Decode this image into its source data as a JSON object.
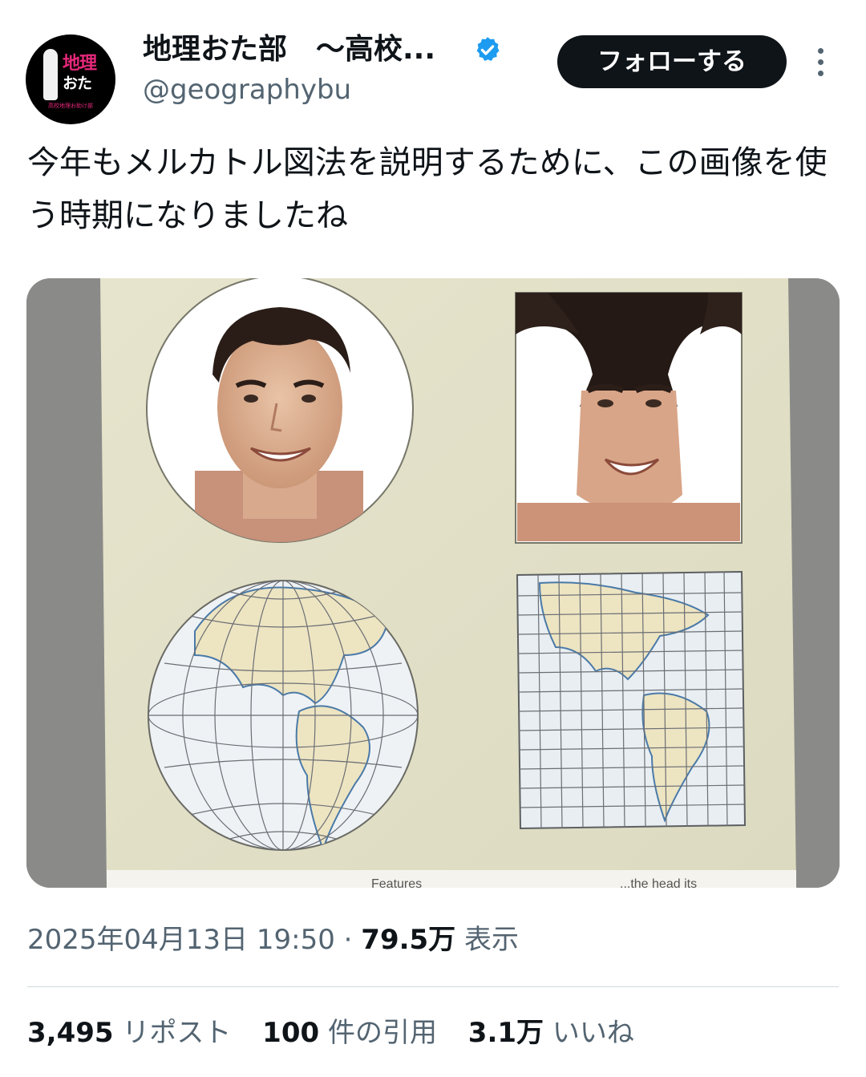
{
  "author": {
    "display_name": "地理おた部　〜高校...",
    "handle": "@geographybu",
    "verified": true,
    "avatar": {
      "line1": "地理",
      "line2": "おた",
      "line3": "高校地理お助け部"
    }
  },
  "follow_button": {
    "label": "フォローする"
  },
  "more_icon": "ellipsis-vertical-icon",
  "tweet": {
    "text": "今年もメルカトル図法を説明するために、この画像を使う時期になりましたね"
  },
  "media": {
    "caption_left": "Features",
    "caption_right": "...the head its"
  },
  "meta": {
    "date": "2025年04月13日 19:50",
    "separator": "·",
    "views_count": "79.5万",
    "views_label": "表示"
  },
  "stats": {
    "reposts_count": "3,495",
    "reposts_label": "リポスト",
    "quotes_count": "100",
    "quotes_label": "件の引用",
    "likes_count": "3.1万",
    "likes_label": "いいね"
  },
  "colors": {
    "text_primary": "#0f1419",
    "text_secondary": "#536471",
    "verified_blue": "#1d9bf0",
    "follow_button_bg": "#0f1419",
    "divider": "#cfd9de"
  }
}
